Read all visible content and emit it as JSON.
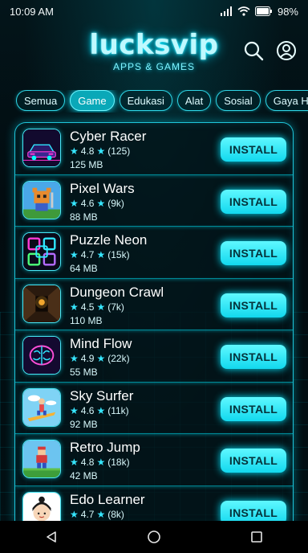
{
  "status_bar": {
    "time": "10:09 AM",
    "battery": "98%"
  },
  "header": {
    "logo": "lucksvip",
    "tagline": "APPS & GAMES"
  },
  "categories": [
    {
      "label": "Semua",
      "active": false
    },
    {
      "label": "Game",
      "active": true
    },
    {
      "label": "Edukasi",
      "active": false
    },
    {
      "label": "Alat",
      "active": false
    },
    {
      "label": "Sosial",
      "active": false
    },
    {
      "label": "Gaya Hidup",
      "active": false
    }
  ],
  "apps": [
    {
      "name": "Cyber Racer",
      "rating": "4.8",
      "reviews": "(125)",
      "size": "125 MB",
      "icon": "race-car-icon",
      "install_label": "INSTALL"
    },
    {
      "name": "Pixel Wars",
      "rating": "4.6",
      "reviews": "(9k)",
      "size": "88 MB",
      "icon": "pixel-warrior-icon",
      "install_label": "INSTALL"
    },
    {
      "name": "Puzzle Neon",
      "rating": "4.7",
      "reviews": "(15k)",
      "size": "64 MB",
      "icon": "neon-puzzle-icon",
      "install_label": "INSTALL"
    },
    {
      "name": "Dungeon Crawl",
      "rating": "4.5",
      "reviews": "(7k)",
      "size": "110 MB",
      "icon": "dungeon-icon",
      "install_label": "INSTALL"
    },
    {
      "name": "Mind Flow",
      "rating": "4.9",
      "reviews": "(22k)",
      "size": "55 MB",
      "icon": "brain-icon",
      "install_label": "INSTALL"
    },
    {
      "name": "Sky Surfer",
      "rating": "4.6",
      "reviews": "(11k)",
      "size": "92 MB",
      "icon": "surfer-icon",
      "install_label": "INSTALL"
    },
    {
      "name": "Retro Jump",
      "rating": "4.8",
      "reviews": "(18k)",
      "size": "42 MB",
      "icon": "retro-jumper-icon",
      "install_label": "INSTALL"
    },
    {
      "name": "Edo Learner",
      "rating": "4.7",
      "reviews": "(8k)",
      "size": "",
      "icon": "learner-icon",
      "install_label": "INSTALL"
    }
  ],
  "colors": {
    "accent": "#12d8ee",
    "background": "#020a0d",
    "glow": "#00e5ff"
  }
}
